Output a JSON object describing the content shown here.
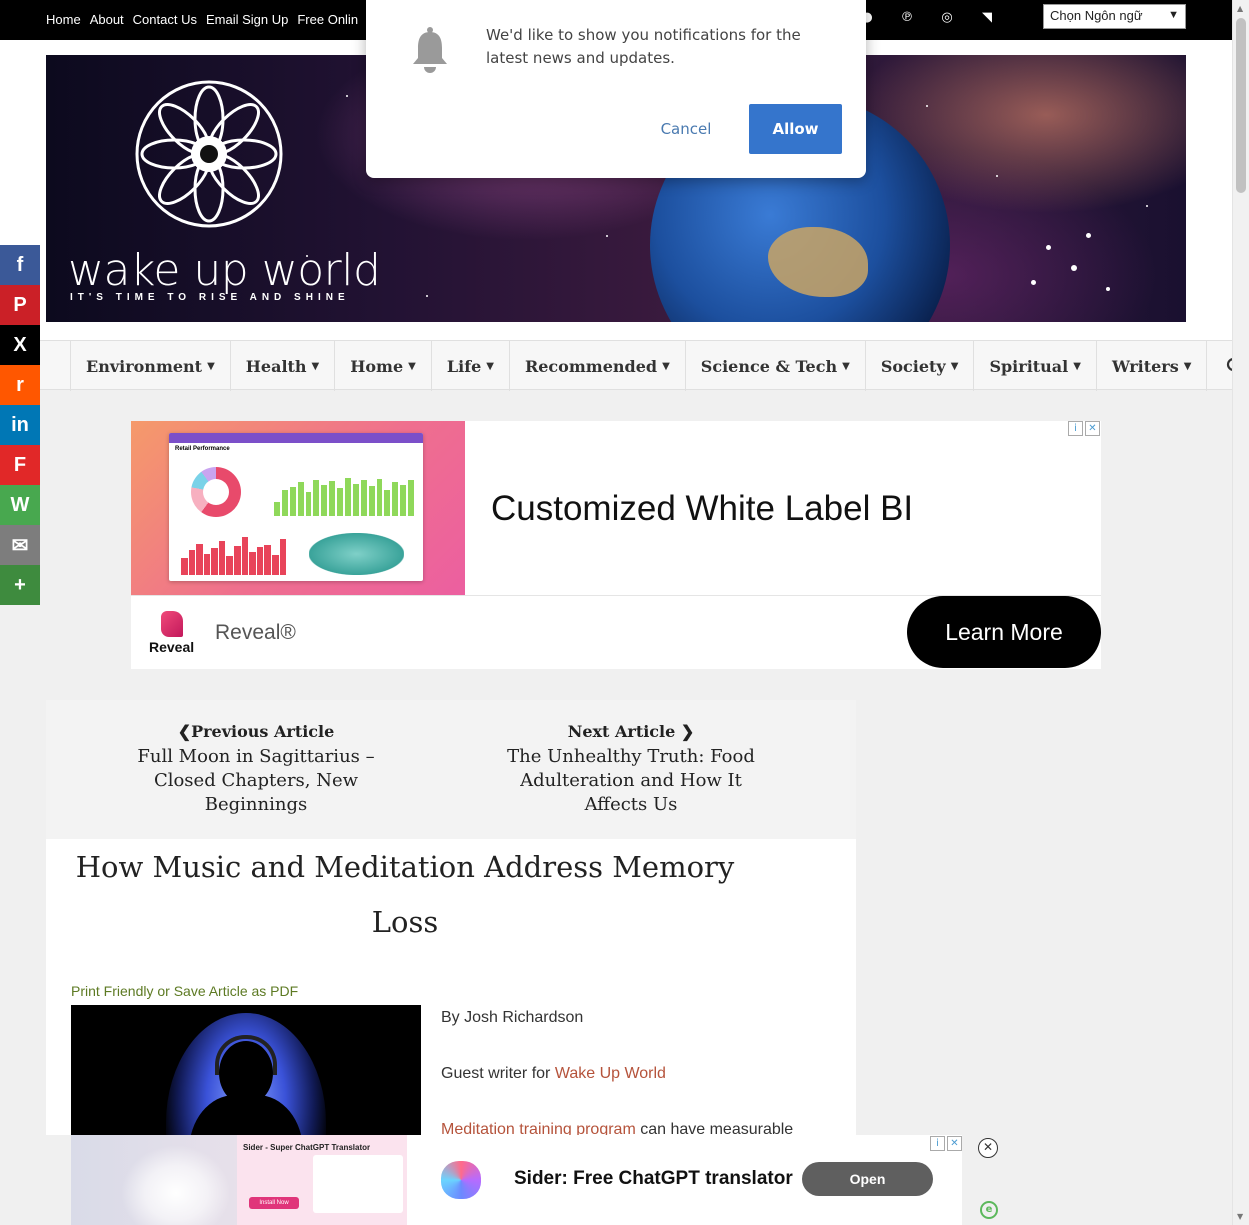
{
  "top_nav": {
    "items": [
      "Home",
      "About",
      "Contact Us",
      "Email Sign Up",
      "Free Onlin"
    ],
    "social_icons": [
      "facebook-icon",
      "pinterest-icon",
      "instagram-icon",
      "rss-icon"
    ],
    "language_select": "Chọn Ngôn ngữ"
  },
  "banner": {
    "logo_text": "wake up world",
    "tagline": "IT'S TIME TO RISE AND SHINE"
  },
  "main_nav": {
    "items": [
      "Environment",
      "Health",
      "Home",
      "Life",
      "Recommended",
      "Science & Tech",
      "Society",
      "Spiritual",
      "Writers"
    ],
    "search_icon": "search-icon"
  },
  "share_bar": {
    "buttons": [
      {
        "name": "facebook",
        "glyph": "f",
        "color": "#3b5998"
      },
      {
        "name": "pinterest",
        "glyph": "P",
        "color": "#cb2027"
      },
      {
        "name": "x",
        "glyph": "X",
        "color": "#000000"
      },
      {
        "name": "reddit",
        "glyph": "r",
        "color": "#ff5700"
      },
      {
        "name": "linkedin",
        "glyph": "in",
        "color": "#0077b5"
      },
      {
        "name": "flipboard",
        "glyph": "F",
        "color": "#e12828"
      },
      {
        "name": "whatsapp",
        "glyph": "W",
        "color": "#48a84f"
      },
      {
        "name": "email",
        "glyph": "✉",
        "color": "#7d7d7d"
      },
      {
        "name": "more",
        "glyph": "+",
        "color": "#3e8b3e"
      }
    ]
  },
  "ad_top": {
    "headline": "Customized White Label BI",
    "brand_logo_text": "Reveal",
    "brand_name": "Reveal®",
    "cta": "Learn More",
    "dashboard_title": "Retail Performance"
  },
  "article_nav": {
    "previous_label": "Previous Article",
    "previous_title": "Full Moon in Sagittarius – Closed Chapters, New Beginnings",
    "next_label": "Next Article",
    "next_title": "The Unhealthy Truth: Food Adulteration and How It Affects Us"
  },
  "article": {
    "title": "How Music and Meditation Address Memory Loss",
    "print_link": "Print Friendly or Save Article as PDF",
    "byline": "By Josh Richardson",
    "guest_prefix": "Guest writer for ",
    "guest_link": "Wake Up World",
    "intro_link": "Meditation training program",
    "intro_rest": " can have measurable"
  },
  "ad_bottom": {
    "image_title": "Sider - Super ChatGPT Translator",
    "image_button": "Install Now",
    "headline": "Sider: Free ChatGPT translator",
    "cta": "Open"
  },
  "notification": {
    "message": "We'd like to show you notifications for the latest news and updates.",
    "cancel": "Cancel",
    "allow": "Allow"
  }
}
